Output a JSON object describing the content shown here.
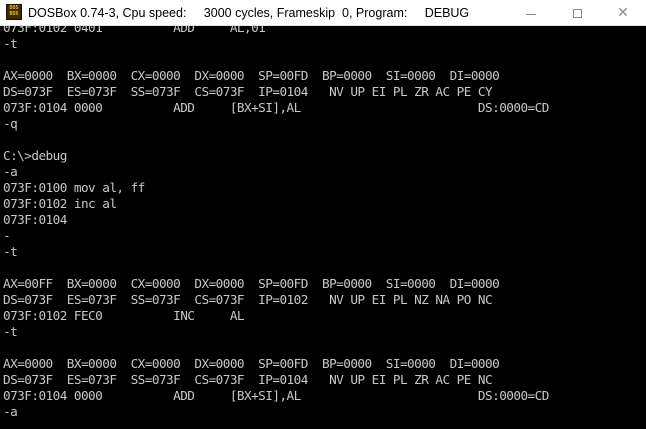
{
  "window": {
    "title": "DOSBox 0.74-3, Cpu speed:     3000 cycles, Frameskip  0, Program:     DEBUG",
    "icon_text_top": "DOS",
    "icon_text_bottom": "BOX",
    "icon": "dosbox-icon",
    "buttons": {
      "minimize": "minimize-icon",
      "maximize": "maximize-icon",
      "close": "✕"
    }
  },
  "console": {
    "lines": [
      "073F:0102 0401          ADD     AL,01",
      "-t",
      "",
      "AX=0000  BX=0000  CX=0000  DX=0000  SP=00FD  BP=0000  SI=0000  DI=0000",
      "DS=073F  ES=073F  SS=073F  CS=073F  IP=0104   NV UP EI PL ZR AC PE CY",
      "073F:0104 0000          ADD     [BX+SI],AL                         DS:0000=CD",
      "-q",
      "",
      "C:\\>debug",
      "-a",
      "073F:0100 mov al, ff",
      "073F:0102 inc al",
      "073F:0104",
      "-",
      "-t",
      "",
      "AX=00FF  BX=0000  CX=0000  DX=0000  SP=00FD  BP=0000  SI=0000  DI=0000",
      "DS=073F  ES=073F  SS=073F  CS=073F  IP=0102   NV UP EI PL NZ NA PO NC",
      "073F:0102 FEC0          INC     AL",
      "-t",
      "",
      "AX=0000  BX=0000  CX=0000  DX=0000  SP=00FD  BP=0000  SI=0000  DI=0000",
      "DS=073F  ES=073F  SS=073F  CS=073F  IP=0104   NV UP EI PL ZR AC PE NC",
      "073F:0104 0000          ADD     [BX+SI],AL                         DS:0000=CD",
      "-a"
    ]
  },
  "colors": {
    "console_bg": "#000000",
    "console_text": "#c8c8c8",
    "titlebar_bg": "#ffffff"
  }
}
